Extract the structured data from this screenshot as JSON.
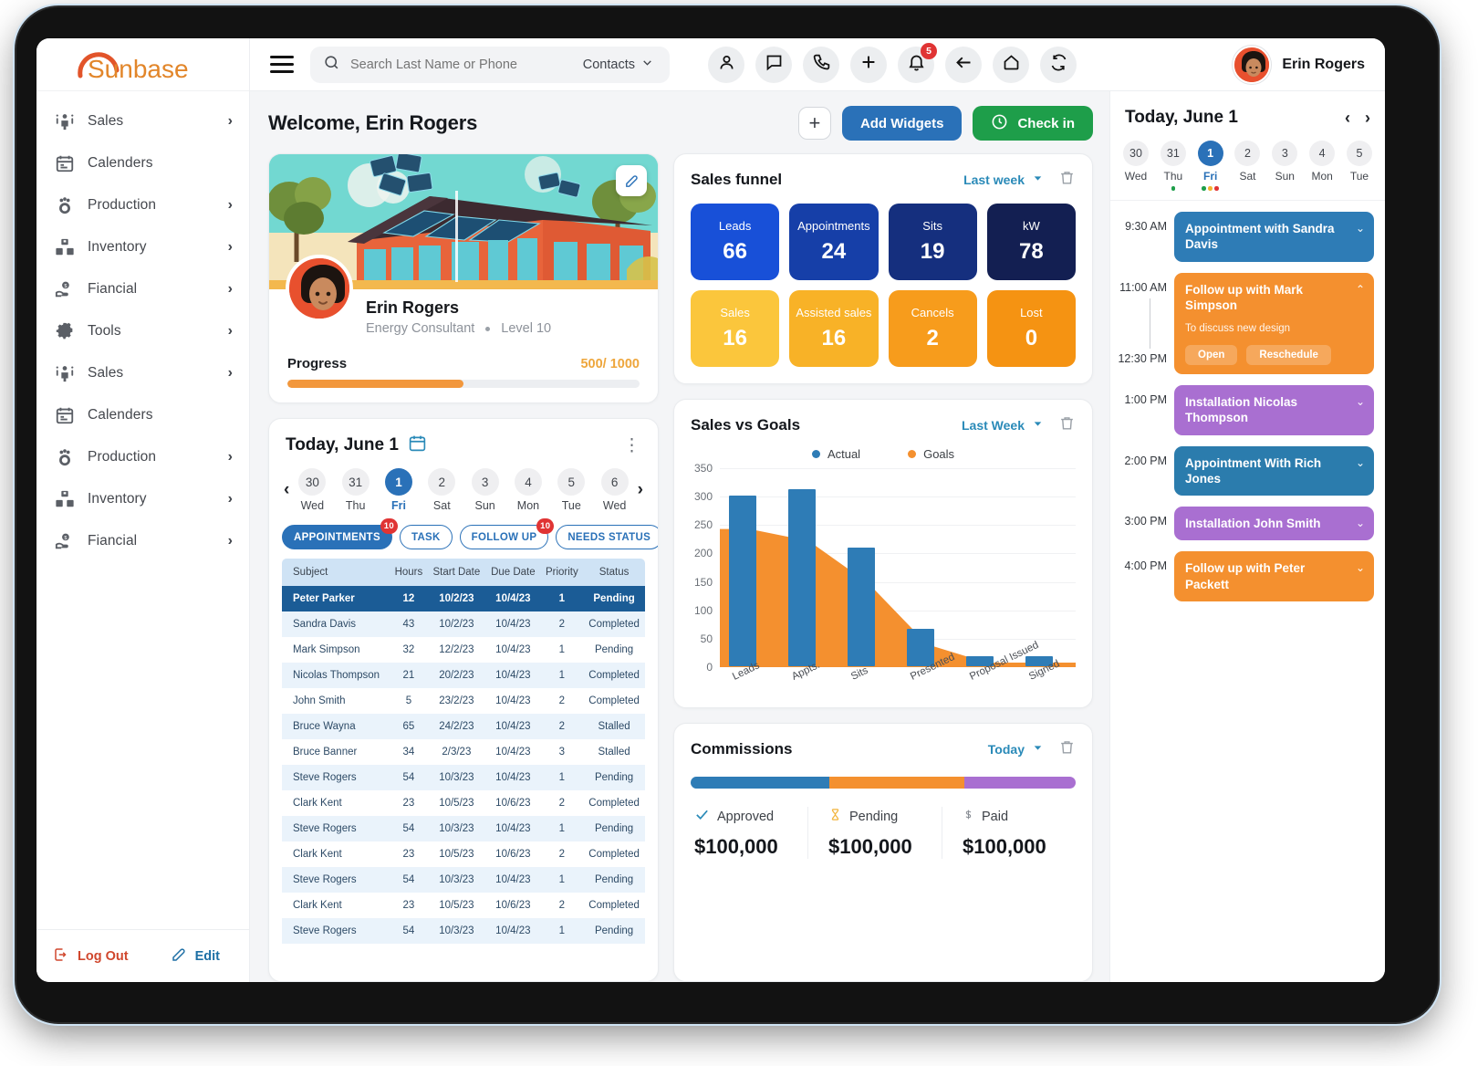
{
  "brand": {
    "name": "Sunbase"
  },
  "sidebar": {
    "items": [
      {
        "label": "Sales",
        "icon": "people-icon",
        "chevron": "›"
      },
      {
        "label": "Calenders",
        "icon": "calendar-icon",
        "chevron": ""
      },
      {
        "label": "Production",
        "icon": "production-icon",
        "chevron": "›"
      },
      {
        "label": "Inventory",
        "icon": "inventory-icon",
        "chevron": "›"
      },
      {
        "label": "Fiancial",
        "icon": "financial-icon",
        "chevron": "›"
      },
      {
        "label": "Tools",
        "icon": "gear-icon",
        "chevron": "›"
      },
      {
        "label": "Sales",
        "icon": "people-icon",
        "chevron": "›"
      },
      {
        "label": "Calenders",
        "icon": "calendar-icon",
        "chevron": ""
      },
      {
        "label": "Production",
        "icon": "production-icon",
        "chevron": "›"
      },
      {
        "label": "Inventory",
        "icon": "inventory-icon",
        "chevron": "›"
      },
      {
        "label": "Fiancial",
        "icon": "financial-icon",
        "chevron": "›"
      }
    ],
    "footer": {
      "logout": "Log Out",
      "edit": "Edit"
    }
  },
  "topbar": {
    "search": {
      "placeholder": "Search Last Name or Phone",
      "value": "",
      "scope": "Contacts"
    },
    "icons": [
      {
        "name": "person-icon",
        "badge": ""
      },
      {
        "name": "chat-icon",
        "badge": ""
      },
      {
        "name": "phone-icon",
        "badge": ""
      },
      {
        "name": "plus-icon",
        "badge": ""
      },
      {
        "name": "bell-icon",
        "badge": "5"
      },
      {
        "name": "back-arrow-icon",
        "badge": ""
      },
      {
        "name": "home-icon",
        "badge": ""
      },
      {
        "name": "refresh-icon",
        "badge": ""
      }
    ],
    "user": "Erin Rogers"
  },
  "header": {
    "welcome": "Welcome, Erin Rogers",
    "add_widget_icon": "+",
    "add_widgets": "Add Widgets",
    "check_in": "Check in"
  },
  "profile": {
    "name": "Erin Rogers",
    "role": "Energy Consultant",
    "level": "Level 10",
    "progress_label": "Progress",
    "progress_value": "500/ 1000",
    "progress_pct": 50
  },
  "today": {
    "title": "Today, June 1",
    "days": [
      {
        "num": "30",
        "name": "Wed",
        "active": false
      },
      {
        "num": "31",
        "name": "Thu",
        "active": false
      },
      {
        "num": "1",
        "name": "Fri",
        "active": true
      },
      {
        "num": "2",
        "name": "Sat",
        "active": false
      },
      {
        "num": "3",
        "name": "Sun",
        "active": false
      },
      {
        "num": "4",
        "name": "Mon",
        "active": false
      },
      {
        "num": "5",
        "name": "Tue",
        "active": false
      },
      {
        "num": "6",
        "name": "Wed",
        "active": false
      }
    ],
    "chips": [
      {
        "label": "APPOINTMENTS",
        "badge": "10",
        "active": true
      },
      {
        "label": "TASK",
        "badge": "",
        "active": false
      },
      {
        "label": "FOLLOW UP",
        "badge": "10",
        "active": false
      },
      {
        "label": "NEEDS STATUS",
        "badge": "",
        "active": false
      }
    ],
    "columns": [
      "Subject",
      "Hours",
      "Start Date",
      "Due Date",
      "Priority",
      "Status"
    ],
    "rows": [
      {
        "subject": "Peter Parker",
        "hours": "12",
        "start": "10/2/23",
        "due": "10/4/23",
        "priority": "1",
        "status": "Pending",
        "selected": true
      },
      {
        "subject": "Sandra Davis",
        "hours": "43",
        "start": "10/2/23",
        "due": "10/4/23",
        "priority": "2",
        "status": "Completed",
        "selected": false
      },
      {
        "subject": "Mark Simpson",
        "hours": "32",
        "start": "12/2/23",
        "due": "10/4/23",
        "priority": "1",
        "status": "Pending",
        "selected": false
      },
      {
        "subject": "Nicolas Thompson",
        "hours": "21",
        "start": "20/2/23",
        "due": "10/4/23",
        "priority": "1",
        "status": "Completed",
        "selected": false
      },
      {
        "subject": "John Smith",
        "hours": "5",
        "start": "23/2/23",
        "due": "10/4/23",
        "priority": "2",
        "status": "Completed",
        "selected": false
      },
      {
        "subject": "Bruce Wayna",
        "hours": "65",
        "start": "24/2/23",
        "due": "10/4/23",
        "priority": "2",
        "status": "Stalled",
        "selected": false
      },
      {
        "subject": "Bruce Banner",
        "hours": "34",
        "start": "2/3/23",
        "due": "10/4/23",
        "priority": "3",
        "status": "Stalled",
        "selected": false
      },
      {
        "subject": "Steve Rogers",
        "hours": "54",
        "start": "10/3/23",
        "due": "10/4/23",
        "priority": "1",
        "status": "Pending",
        "selected": false
      },
      {
        "subject": "Clark Kent",
        "hours": "23",
        "start": "10/5/23",
        "due": "10/6/23",
        "priority": "2",
        "status": "Completed",
        "selected": false
      },
      {
        "subject": "Steve Rogers",
        "hours": "54",
        "start": "10/3/23",
        "due": "10/4/23",
        "priority": "1",
        "status": "Pending",
        "selected": false
      },
      {
        "subject": "Clark Kent",
        "hours": "23",
        "start": "10/5/23",
        "due": "10/6/23",
        "priority": "2",
        "status": "Completed",
        "selected": false
      },
      {
        "subject": "Steve Rogers",
        "hours": "54",
        "start": "10/3/23",
        "due": "10/4/23",
        "priority": "1",
        "status": "Pending",
        "selected": false
      },
      {
        "subject": "Clark Kent",
        "hours": "23",
        "start": "10/5/23",
        "due": "10/6/23",
        "priority": "2",
        "status": "Completed",
        "selected": false
      },
      {
        "subject": "Steve Rogers",
        "hours": "54",
        "start": "10/3/23",
        "due": "10/4/23",
        "priority": "1",
        "status": "Pending",
        "selected": false
      }
    ]
  },
  "sales_funnel": {
    "title": "Sales funnel",
    "range": "Last week",
    "cells": [
      {
        "label": "Leads",
        "value": "66",
        "color": "#1850d8"
      },
      {
        "label": "Appointments",
        "value": "24",
        "color": "#163fa8"
      },
      {
        "label": "Sits",
        "value": "19",
        "color": "#152f7e"
      },
      {
        "label": "kW",
        "value": "78",
        "color": "#131f52"
      },
      {
        "label": "Sales",
        "value": "16",
        "color": "#fbc63c"
      },
      {
        "label": "Assisted sales",
        "value": "16",
        "color": "#f8b227"
      },
      {
        "label": "Cancels",
        "value": "2",
        "color": "#f79c1c"
      },
      {
        "label": "Lost",
        "value": "0",
        "color": "#f59312"
      }
    ]
  },
  "chart_data": {
    "type": "bar",
    "title": "Sales vs Goals",
    "range": "Last Week",
    "categories": [
      "Leads",
      "Appts.",
      "Sits",
      "Presented",
      "Proposal Issued",
      "Signed"
    ],
    "series": [
      {
        "name": "Actual",
        "color": "#2e7cb6",
        "values": [
          300,
          312,
          208,
          66,
          18,
          18
        ]
      },
      {
        "name": "Goals",
        "color": "#f4902f",
        "values": [
          243,
          222,
          148,
          40,
          8,
          8
        ]
      }
    ],
    "ylim": [
      0,
      350
    ],
    "yticks": [
      0,
      50,
      100,
      150,
      200,
      250,
      300,
      350
    ],
    "xlabel": "",
    "ylabel": "",
    "grid": true,
    "legend_position": "top"
  },
  "commissions": {
    "title": "Commissions",
    "range": "Today",
    "segments": [
      {
        "color": "#2e7cb6",
        "pct": 36
      },
      {
        "color": "#f4902f",
        "pct": 35
      },
      {
        "color": "#a96fd1",
        "pct": 29
      }
    ],
    "stats": [
      {
        "icon": "check-icon",
        "label": "Approved",
        "amount": "$100,000"
      },
      {
        "icon": "hourglass-icon",
        "label": "Pending",
        "amount": "$100,000"
      },
      {
        "icon": "dollar-icon",
        "label": "Paid",
        "amount": "$100,000"
      }
    ]
  },
  "schedule": {
    "title": "Today, June 1",
    "days": [
      {
        "num": "30",
        "name": "Wed",
        "active": false,
        "dots": []
      },
      {
        "num": "31",
        "name": "Thu",
        "active": false,
        "dots": [
          "#1e9e4a"
        ]
      },
      {
        "num": "1",
        "name": "Fri",
        "active": true,
        "dots": [
          "#1e9e4a",
          "#f4b32f",
          "#e03434"
        ]
      },
      {
        "num": "2",
        "name": "Sat",
        "active": false,
        "dots": []
      },
      {
        "num": "3",
        "name": "Sun",
        "active": false,
        "dots": []
      },
      {
        "num": "4",
        "name": "Mon",
        "active": false,
        "dots": []
      },
      {
        "num": "5",
        "name": "Tue",
        "active": false,
        "dots": []
      }
    ],
    "events": [
      {
        "time": "9:30 AM",
        "end_time": "",
        "title": "Appointment with Sandra Davis",
        "sub": "",
        "color": "#2e7cb6",
        "actions": [],
        "chevron": "⌄"
      },
      {
        "time": "11:00 AM",
        "end_time": "12:30 PM",
        "title": "Follow up with Mark Simpson",
        "sub": "To discuss new design",
        "color": "#f4902f",
        "actions": [
          "Open",
          "Reschedule"
        ],
        "chevron": "⌃"
      },
      {
        "time": "1:00 PM",
        "end_time": "",
        "title": "Installation Nicolas Thompson",
        "sub": "",
        "color": "#a96fd1",
        "actions": [],
        "chevron": "⌄"
      },
      {
        "time": "2:00 PM",
        "end_time": "",
        "title": "Appointment With Rich Jones",
        "sub": "",
        "color": "#2b7cad",
        "actions": [],
        "chevron": "⌄"
      },
      {
        "time": "3:00 PM",
        "end_time": "",
        "title": "Installation John Smith",
        "sub": "",
        "color": "#a96fd1",
        "actions": [],
        "chevron": "⌄"
      },
      {
        "time": "4:00 PM",
        "end_time": "",
        "title": "Follow up with Peter Packett",
        "sub": "",
        "color": "#f4902f",
        "actions": [],
        "chevron": "⌄"
      }
    ]
  }
}
